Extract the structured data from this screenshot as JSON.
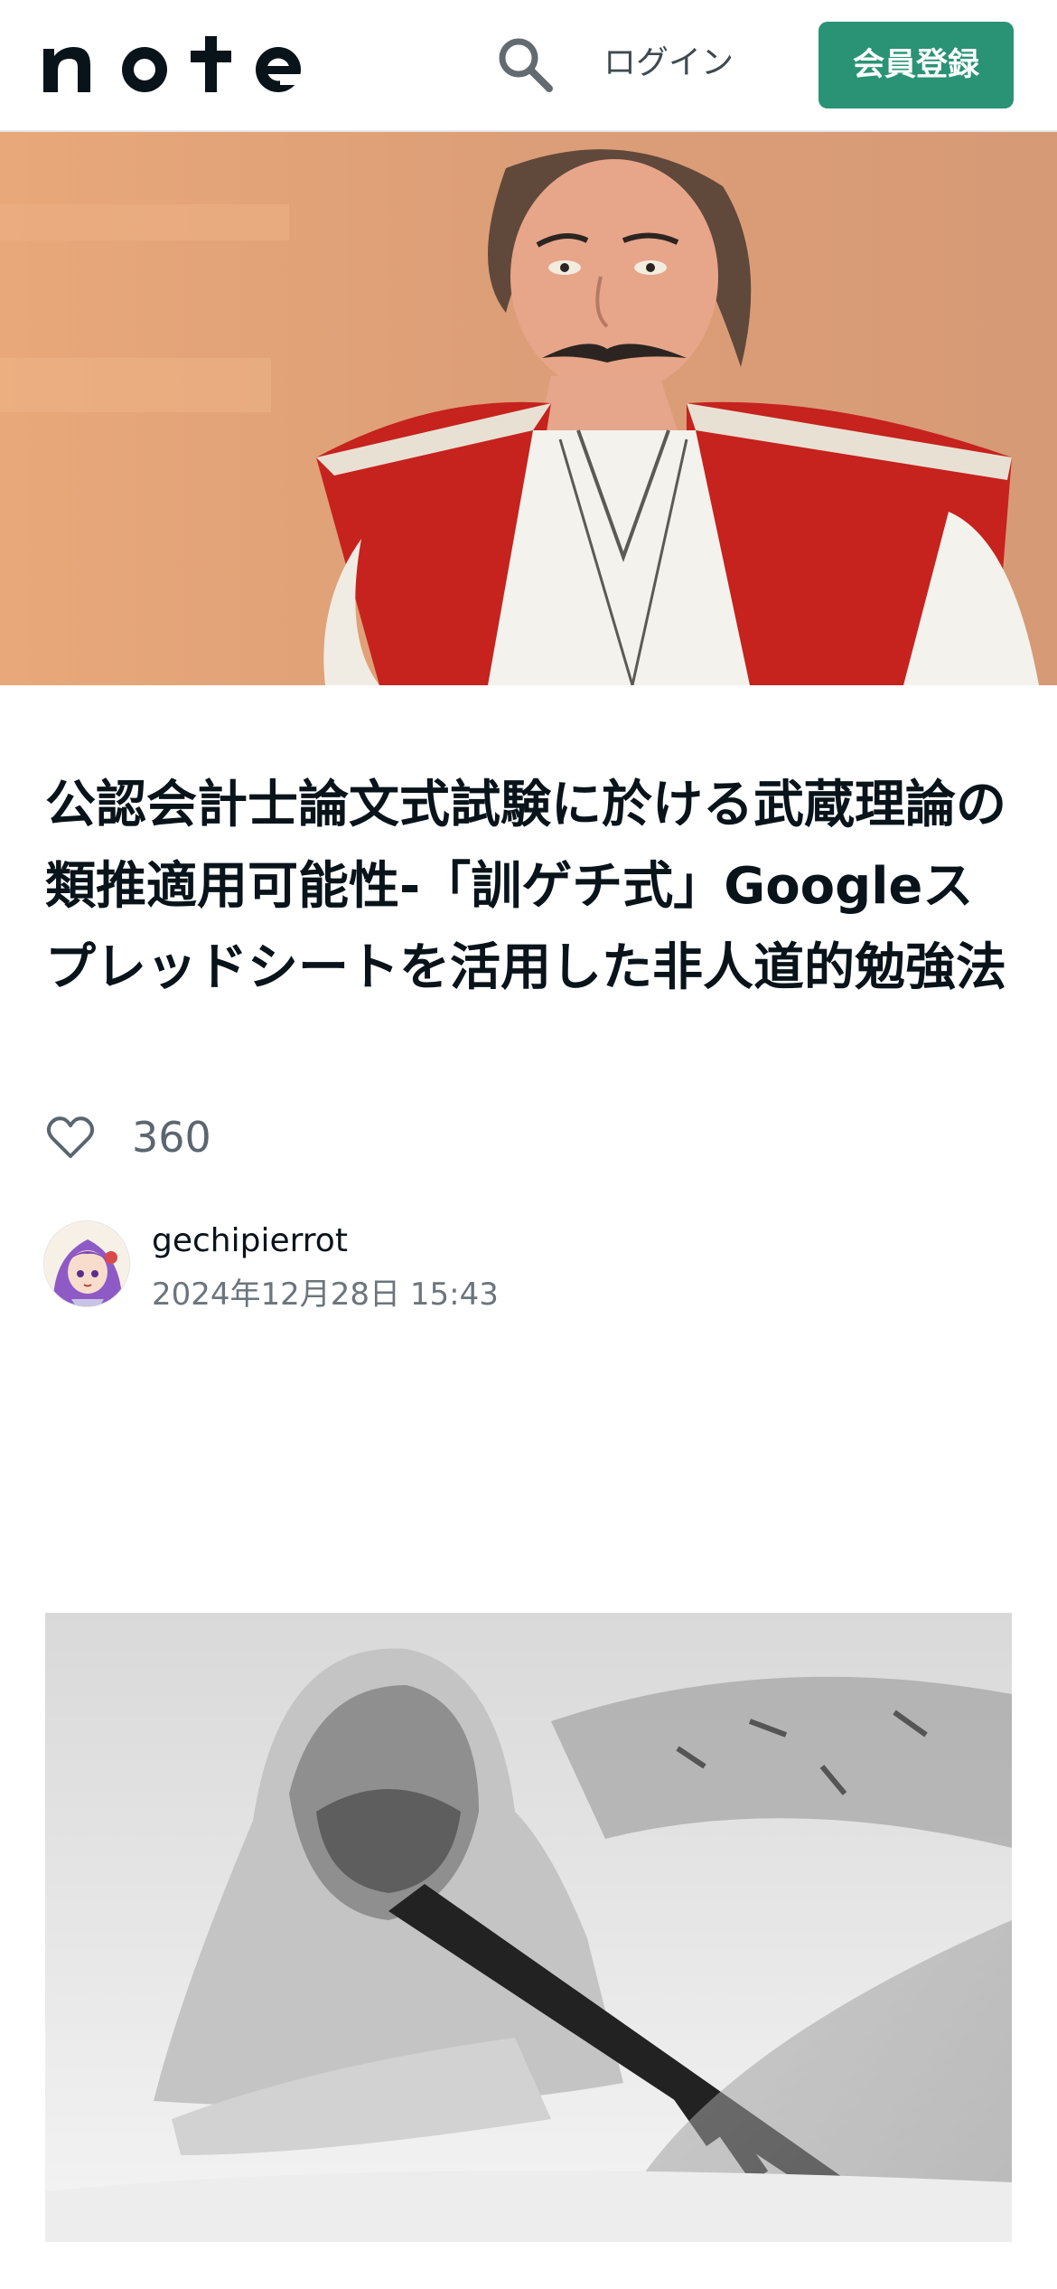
{
  "header": {
    "logo_text": "note",
    "search_icon": "search-icon",
    "login_label": "ログイン",
    "signup_label": "会員登録",
    "signup_color": "#2a9375"
  },
  "hero": {
    "icon": "portrait-painting-image"
  },
  "article": {
    "title": "公認会計士論文式試験に於ける武蔵理論の類推適用可能性-「訓ゲチ式」Googleスプレッドシートを活用した非人道的勉強法",
    "like_icon": "heart-icon",
    "like_count": "360",
    "author": {
      "name": "gechipierrot",
      "date": "2024年12月28日 15:43",
      "avatar_icon": "avatar-image"
    }
  },
  "content": {
    "image_icon": "soldier-in-snow-photo"
  }
}
